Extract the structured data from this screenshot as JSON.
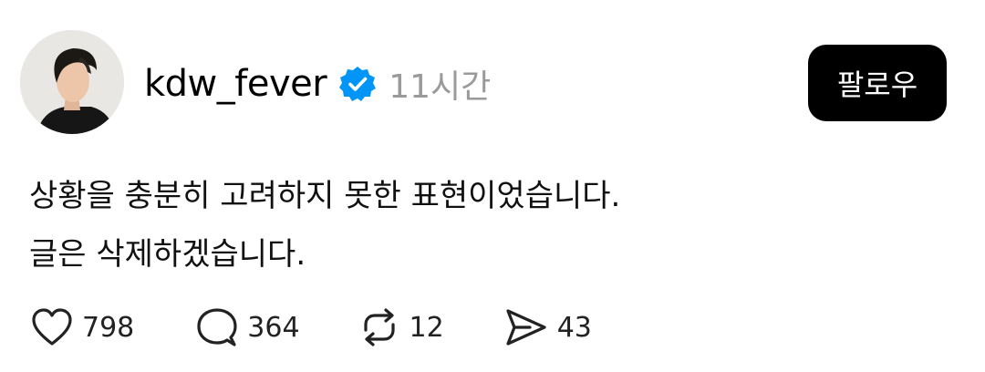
{
  "post": {
    "username": "kdw_fever",
    "timestamp": "11시간",
    "follow_label": "팔로우",
    "body_lines": [
      "상황을 충분히 고려하지 못한 표현이었습니다.",
      "글은 삭제하겠습니다."
    ],
    "actions": {
      "likes": "798",
      "comments": "364",
      "reposts": "12",
      "shares": "43"
    },
    "icons": {
      "verified": "verified-badge-icon",
      "like": "heart-icon",
      "comment": "comment-bubble-icon",
      "repost": "repost-icon",
      "share": "send-icon"
    },
    "colors": {
      "verified": "#0095f6",
      "follow_bg": "#000000",
      "timestamp": "#9a9a9a"
    }
  }
}
